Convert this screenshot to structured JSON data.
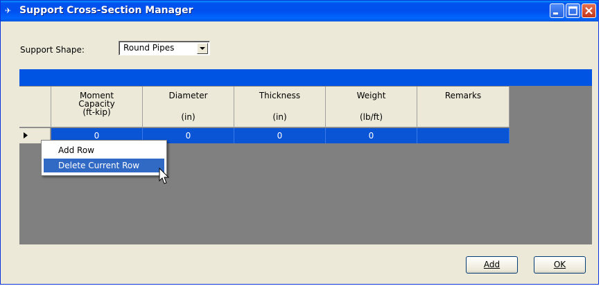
{
  "window": {
    "title": "Support Cross-Section Manager",
    "icon_glyph": "✈",
    "controls": [
      "minimize-icon",
      "maximize-icon",
      "close-icon"
    ]
  },
  "support_shape": {
    "label": "Support Shape:",
    "value": "Round Pipes"
  },
  "grid": {
    "columns": [
      {
        "line1": "Moment",
        "line2": "Capacity",
        "unit": "(ft-kip)"
      },
      {
        "line1": "Diameter",
        "line2": "",
        "unit": "(in)"
      },
      {
        "line1": "Thickness",
        "line2": "",
        "unit": "(in)"
      },
      {
        "line1": "Weight",
        "line2": "",
        "unit": "(lb/ft)"
      },
      {
        "line1": "Remarks",
        "line2": "",
        "unit": ""
      }
    ],
    "rows": [
      {
        "cells": [
          "0",
          "0",
          "0",
          "0",
          ""
        ]
      }
    ]
  },
  "context_menu": {
    "items": [
      {
        "label": "Add Row",
        "selected": false
      },
      {
        "label": "Delete Current Row",
        "selected": true
      }
    ]
  },
  "buttons": {
    "add_label": "Add",
    "ok_label": "OK"
  },
  "colors": {
    "title_bar": "#0054e3",
    "selection": "#316ac5",
    "grid_background": "#808080",
    "dialog_face": "#ece9d8"
  }
}
